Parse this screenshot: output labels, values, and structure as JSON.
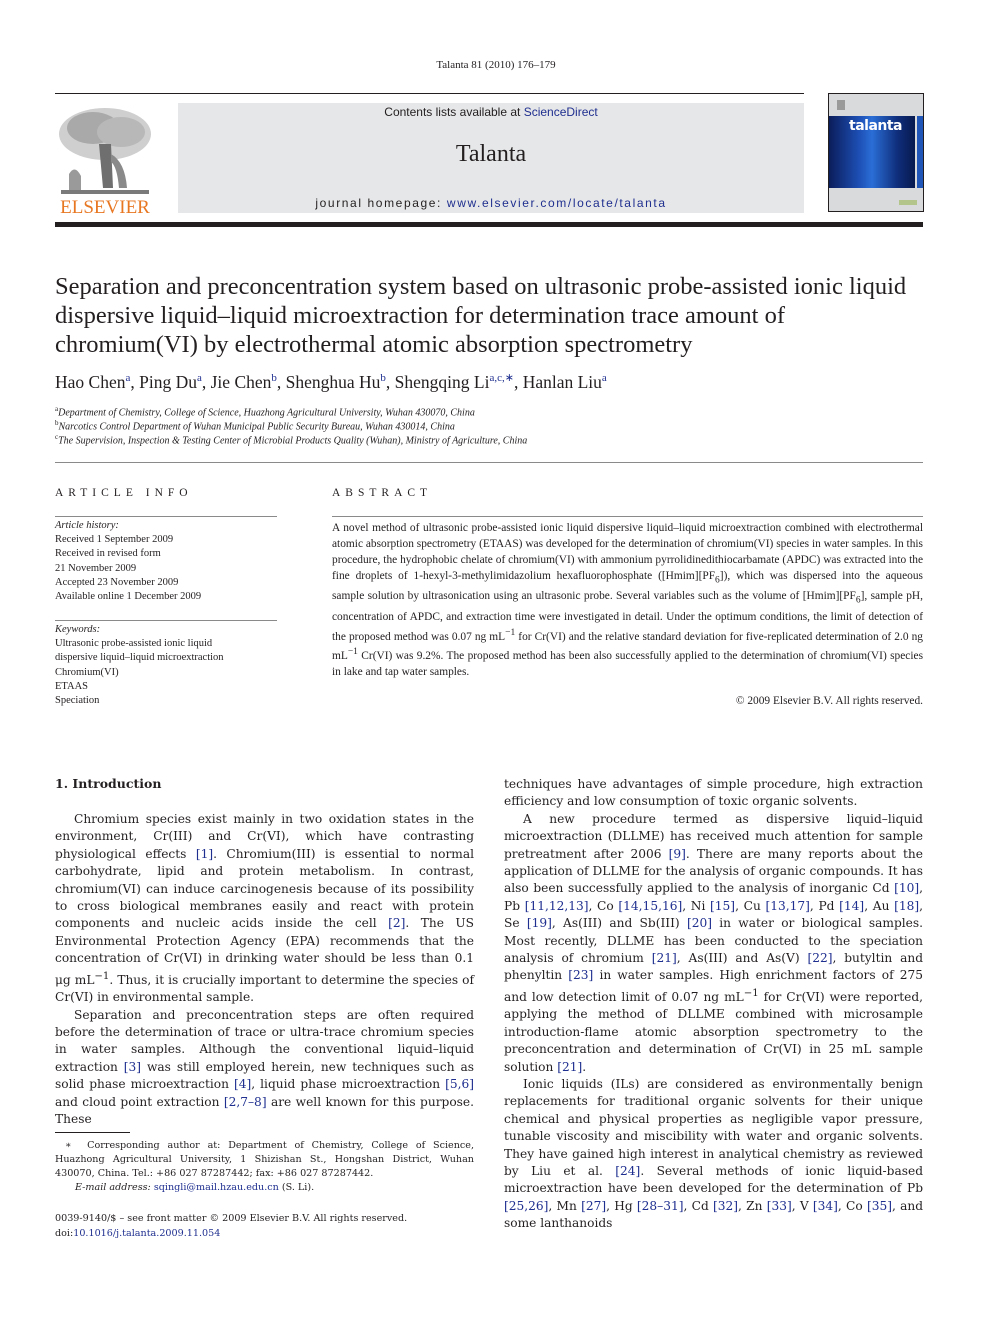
{
  "running_head": "Talanta 81 (2010) 176–179",
  "masthead": {
    "publisher_logo_text": "ELSEVIER",
    "contents_prefix": "Contents lists available at ",
    "contents_link": "ScienceDirect",
    "journal_title": "Talanta",
    "homepage_prefix": "journal homepage: ",
    "homepage_link": "www.elsevier.com/locate/talanta",
    "cover_title": "talanta"
  },
  "article": {
    "title": "Separation and preconcentration system based on ultrasonic probe-assisted ionic liquid dispersive liquid–liquid microextraction for determination trace amount of chromium(VI) by electrothermal atomic absorption spectrometry",
    "authors": [
      {
        "name": "Hao Chen",
        "sup": "a",
        "sep": ", "
      },
      {
        "name": "Ping Du",
        "sup": "a",
        "sep": ", "
      },
      {
        "name": "Jie Chen",
        "sup": "b",
        "sep": ", "
      },
      {
        "name": "Shenghua Hu",
        "sup": "b",
        "sep": ", "
      },
      {
        "name": "Shengqing Li",
        "sup": "a,c,∗",
        "sep": ", "
      },
      {
        "name": "Hanlan Liu",
        "sup": "a",
        "sep": ""
      }
    ],
    "affiliations": [
      {
        "mark": "a",
        "text": "Department of Chemistry, College of Science, Huazhong Agricultural University, Wuhan 430070, China"
      },
      {
        "mark": "b",
        "text": "Narcotics Control Department of Wuhan Municipal Public Security Bureau, Wuhan 430014, China"
      },
      {
        "mark": "c",
        "text": "The Supervision, Inspection & Testing Center of Microbial Products Quality (Wuhan), Ministry of Agriculture, China"
      }
    ]
  },
  "article_info": {
    "heading": "ARTICLE INFO",
    "history_label": "Article history:",
    "history": [
      "Received 1 September 2009",
      "Received in revised form",
      "21 November 2009",
      "Accepted 23 November 2009",
      "Available online 1 December 2009"
    ],
    "keywords_label": "Keywords:",
    "keywords": [
      "Ultrasonic probe-assisted ionic liquid",
      "dispersive liquid–liquid microextraction",
      "Chromium(VI)",
      "ETAAS",
      "Speciation"
    ]
  },
  "abstract": {
    "heading": "ABSTRACT",
    "text_1": "A novel method of ultrasonic probe-assisted ionic liquid dispersive liquid–liquid microextraction combined with electrothermal atomic absorption spectrometry (ETAAS) was developed for the determination of chromium(VI) species in water samples. In this procedure, the hydrophobic chelate of chromium(VI) with ammonium pyrrolidinedithiocarbamate (APDC) was extracted into the fine droplets of 1-hexyl-3-methylimidazolium hexafluorophosphate ([Hmim][PF",
    "sub_1": "6",
    "text_2": "]), which was dispersed into the aqueous sample solution by ultrasonication using an ultrasonic probe. Several variables such as the volume of [Hmim][PF",
    "sub_2": "6",
    "text_3": "], sample pH, concentration of APDC, and extraction time were investigated in detail. Under the optimum conditions, the limit of detection of the proposed method was 0.07 ng mL",
    "sup_1": "−1",
    "text_4": " for Cr(VI) and the relative standard deviation for five-replicated determination of 2.0 ng mL",
    "sup_2": "−1",
    "text_5": " Cr(VI) was 9.2%. The proposed method has been also successfully applied to the determination of chromium(VI) species in lake and tap water samples.",
    "copyright": "© 2009 Elsevier B.V. All rights reserved."
  },
  "introduction": {
    "heading": "1.  Introduction",
    "p1": [
      {
        "t": "Chromium species exist mainly in two oxidation states in the environment, Cr(III) and Cr(VI), which have contrasting physiological effects "
      },
      {
        "r": "[1]"
      },
      {
        "t": ". Chromium(III) is essential to normal carbohydrate, lipid and protein metabolism. In contrast, chromium(VI) can induce carcinogenesis because of its possibility to cross biological membranes easily and react with protein components and nucleic acids inside the cell "
      },
      {
        "r": "[2]"
      },
      {
        "t": ". The US Environmental Protection Agency (EPA) recommends that the concentration of Cr(VI) in drinking water should be less than 0.1 μg mL"
      },
      {
        "s": "−1"
      },
      {
        "t": ". Thus, it is crucially important to determine the species of Cr(VI) in environmental sample."
      }
    ],
    "p2": [
      {
        "t": "Separation and preconcentration steps are often required before the determination of trace or ultra-trace chromium species in water samples. Although the conventional liquid–liquid extraction "
      },
      {
        "r": "[3]"
      },
      {
        "t": " was still employed herein, new techniques such as solid phase microextraction "
      },
      {
        "r": "[4]"
      },
      {
        "t": ", liquid phase microextraction "
      },
      {
        "r": "[5,6]"
      },
      {
        "t": " and cloud point extraction "
      },
      {
        "r": "[2,7–8]"
      },
      {
        "t": " are well known for this purpose. These"
      }
    ],
    "p3": [
      {
        "t": "techniques have advantages of simple procedure, high extraction efficiency and low consumption of toxic organic solvents."
      }
    ],
    "p4": [
      {
        "t": "A new procedure termed as dispersive liquid–liquid microextraction (DLLME) has received much attention for sample pretreatment after 2006 "
      },
      {
        "r": "[9]"
      },
      {
        "t": ". There are many reports about the application of DLLME for the analysis of organic compounds. It has also been successfully applied to the analysis of inorganic Cd "
      },
      {
        "r": "[10]"
      },
      {
        "t": ", Pb "
      },
      {
        "r": "[11,12,13]"
      },
      {
        "t": ", Co "
      },
      {
        "r": "[14,15,16]"
      },
      {
        "t": ", Ni "
      },
      {
        "r": "[15]"
      },
      {
        "t": ", Cu "
      },
      {
        "r": "[13,17]"
      },
      {
        "t": ", Pd "
      },
      {
        "r": "[14]"
      },
      {
        "t": ", Au "
      },
      {
        "r": "[18]"
      },
      {
        "t": ", Se "
      },
      {
        "r": "[19]"
      },
      {
        "t": ", As(III) and Sb(III) "
      },
      {
        "r": "[20]"
      },
      {
        "t": " in water or biological samples. Most recently, DLLME has been conducted to the speciation analysis of chromium "
      },
      {
        "r": "[21]"
      },
      {
        "t": ", As(III) and As(V) "
      },
      {
        "r": "[22]"
      },
      {
        "t": ", butyltin and phenyltin "
      },
      {
        "r": "[23]"
      },
      {
        "t": " in water samples. High enrichment factors of 275 and low detection limit of 0.07 ng mL"
      },
      {
        "s": "−1"
      },
      {
        "t": " for Cr(VI) were reported, applying the method of DLLME combined with microsample introduction-flame atomic absorption spectrometry to the preconcentration and determination of Cr(VI) in 25 mL sample solution "
      },
      {
        "r": "[21]"
      },
      {
        "t": "."
      }
    ],
    "p5": [
      {
        "t": "Ionic liquids (ILs) are considered as environmentally benign replacements for traditional organic solvents for their unique chemical and physical properties as negligible vapor pressure, tunable viscosity and miscibility with water and organic solvents. They have gained high interest in analytical chemistry as reviewed by Liu et al. "
      },
      {
        "r": "[24]"
      },
      {
        "t": ". Several methods of ionic liquid-based microextraction have been developed for the determination of Pb "
      },
      {
        "r": "[25,26]"
      },
      {
        "t": ", Mn "
      },
      {
        "r": "[27]"
      },
      {
        "t": ", Hg "
      },
      {
        "r": "[28–31]"
      },
      {
        "t": ", Cd "
      },
      {
        "r": "[32]"
      },
      {
        "t": ", Zn "
      },
      {
        "r": "[33]"
      },
      {
        "t": ", V "
      },
      {
        "r": "[34]"
      },
      {
        "t": ", Co "
      },
      {
        "r": "[35]"
      },
      {
        "t": ", and some lanthanoids"
      }
    ]
  },
  "footnote": {
    "mark": "∗",
    "text": "Corresponding author at: Department of Chemistry, College of Science, Huazhong Agricultural University, 1 Shizishan St., Hongshan District, Wuhan 430070, China. Tel.: +86 027 87287442; fax: +86 027 87287442.",
    "email_label": "E-mail address:",
    "email": "sqingli@mail.hzau.edu.cn",
    "email_suffix": " (S. Li)."
  },
  "front_matter": {
    "issn_line": "0039-9140/$ – see front matter © 2009 Elsevier B.V. All rights reserved.",
    "doi_prefix": "doi:",
    "doi": "10.1016/j.talanta.2009.11.054"
  }
}
